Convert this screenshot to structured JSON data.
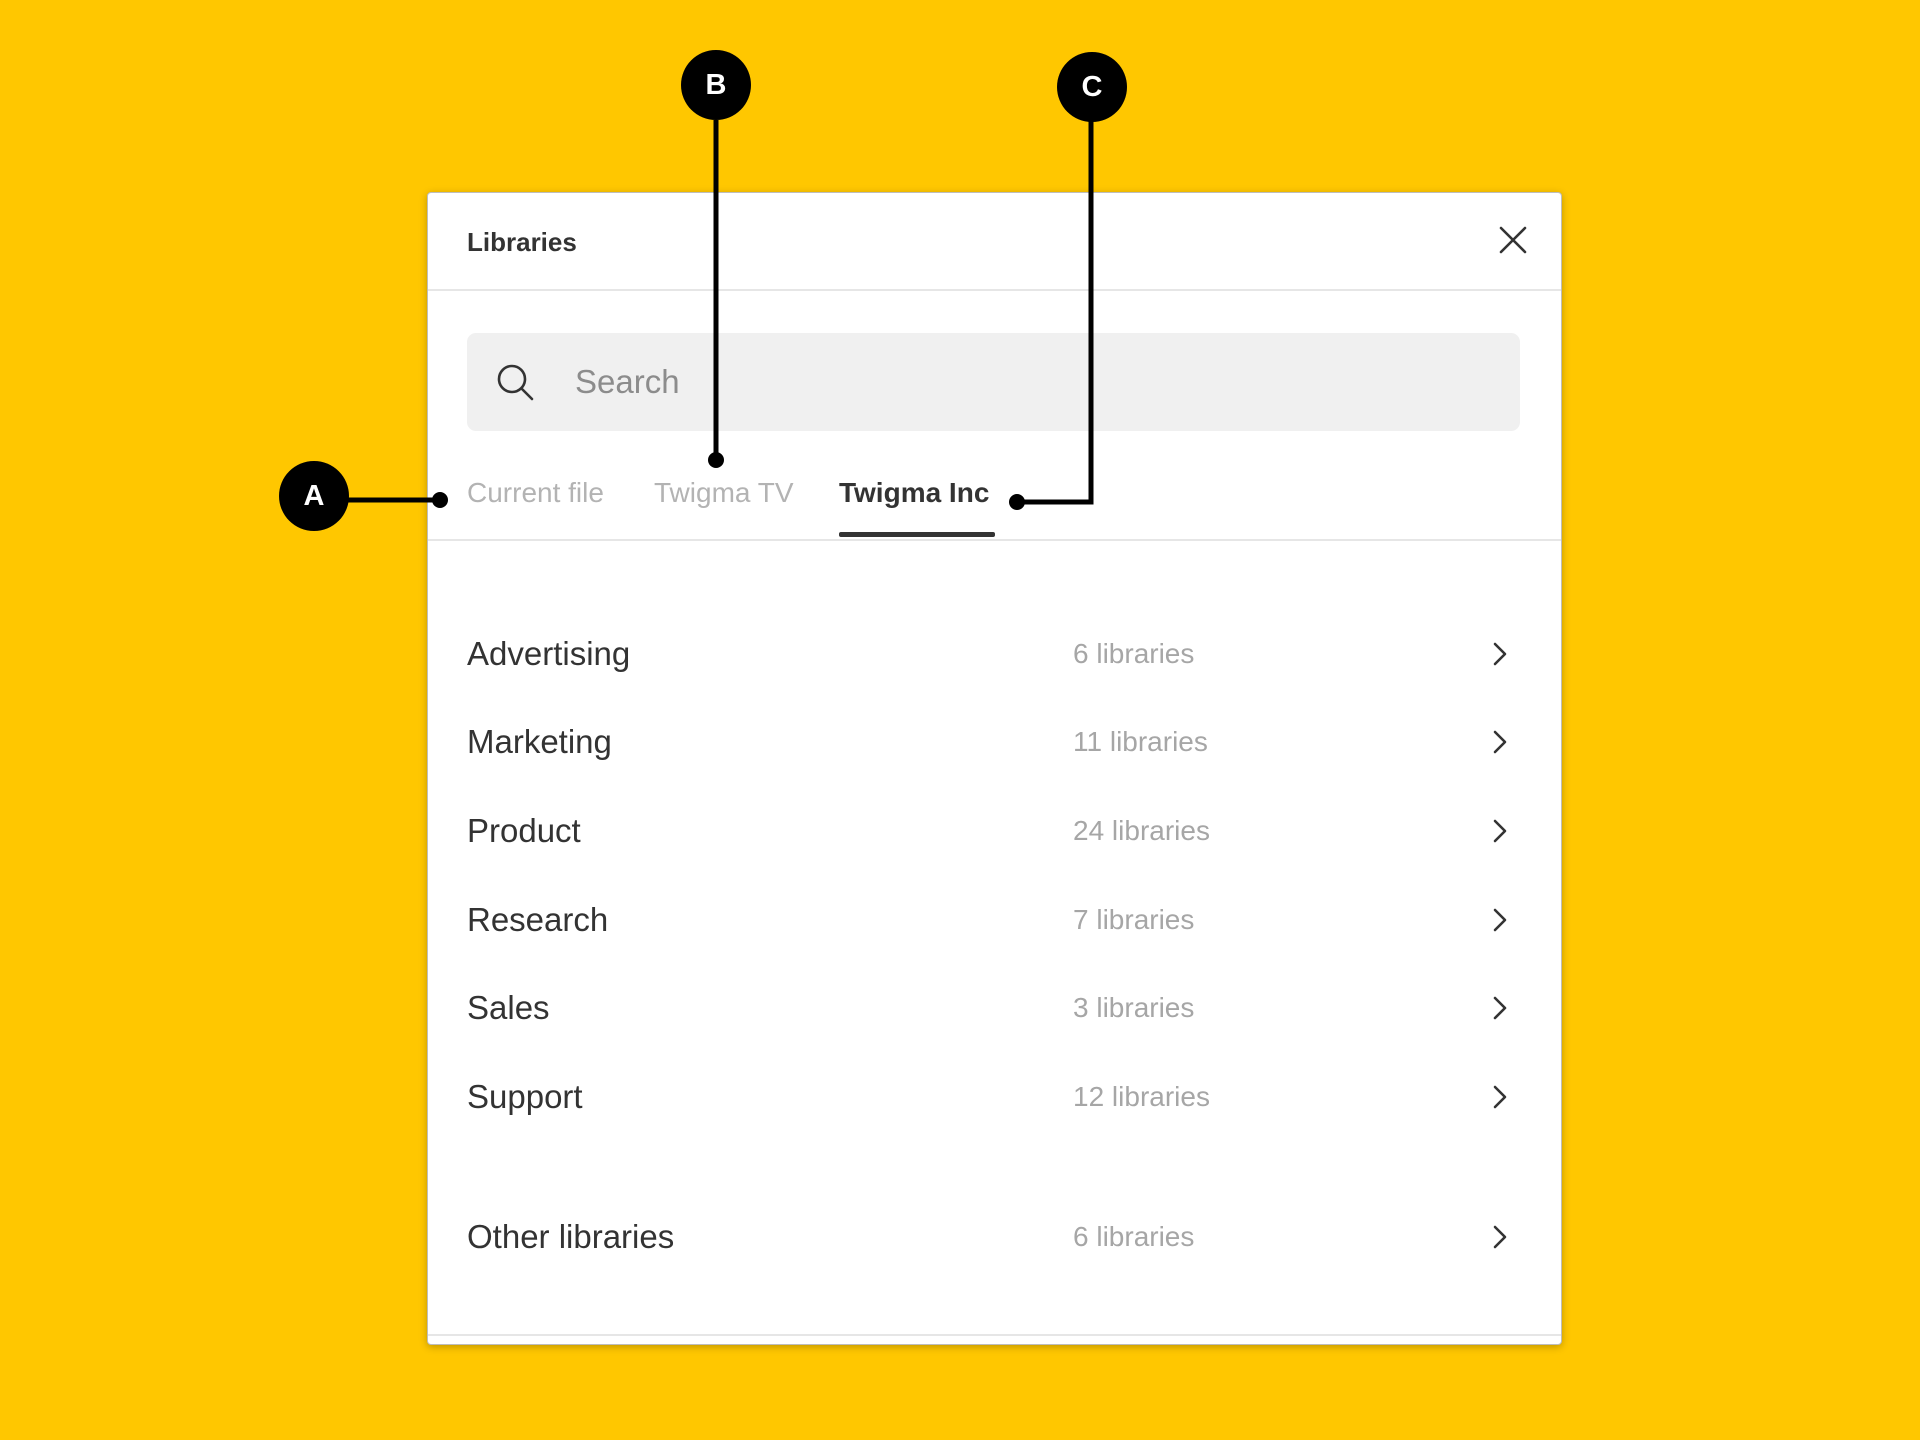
{
  "callouts": [
    {
      "label": "A"
    },
    {
      "label": "B"
    },
    {
      "label": "C"
    }
  ],
  "panel": {
    "title": "Libraries",
    "close_icon": "close-icon",
    "search": {
      "icon": "search-icon",
      "placeholder": "Search",
      "value": ""
    },
    "tabs": [
      {
        "label": "Current file",
        "active": false
      },
      {
        "label": "Twigma TV",
        "active": false
      },
      {
        "label": "Twigma Inc",
        "active": true
      }
    ],
    "teams": [
      {
        "name": "Advertising",
        "count": "6 libraries"
      },
      {
        "name": "Marketing",
        "count": "11 libraries"
      },
      {
        "name": "Product",
        "count": "24 libraries"
      },
      {
        "name": "Research",
        "count": "7 libraries"
      },
      {
        "name": "Sales",
        "count": "3 libraries"
      },
      {
        "name": "Support",
        "count": "12 libraries"
      }
    ],
    "other": {
      "name": "Other libraries",
      "count": "6 libraries"
    }
  },
  "colors": {
    "background": "#FFC700",
    "text_primary": "#333333",
    "text_muted": "#A6A6A6",
    "callout": "#000000"
  }
}
